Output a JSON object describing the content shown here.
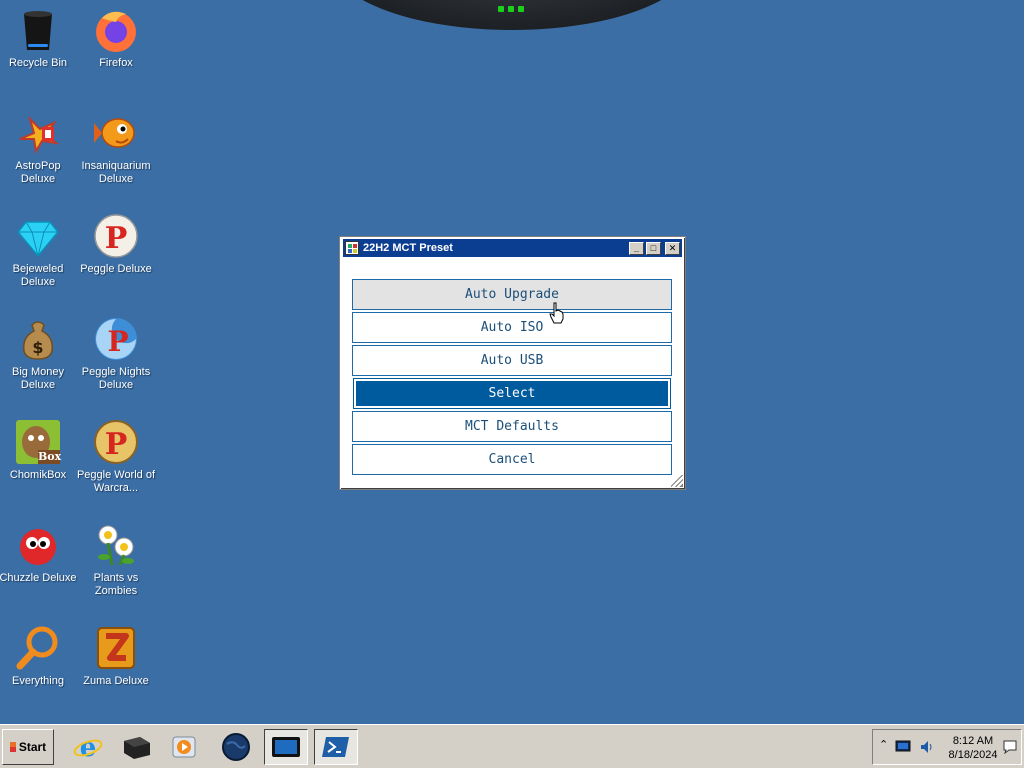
{
  "desktop": {
    "icons": [
      {
        "label": "Recycle Bin",
        "icon": "recycle-bin-icon"
      },
      {
        "label": "Firefox",
        "icon": "firefox-icon"
      },
      {
        "label": "AstroPop Deluxe",
        "icon": "astropop-icon"
      },
      {
        "label": "Insaniquarium Deluxe",
        "icon": "insaniquarium-icon"
      },
      {
        "label": "Bejeweled Deluxe",
        "icon": "bejeweled-icon"
      },
      {
        "label": "Peggle Deluxe",
        "icon": "peggle-icon"
      },
      {
        "label": "Big Money Deluxe",
        "icon": "big-money-icon"
      },
      {
        "label": "Peggle Nights Deluxe",
        "icon": "peggle-nights-icon"
      },
      {
        "label": "ChomikBox",
        "icon": "chomikbox-icon"
      },
      {
        "label": "Peggle World of Warcra...",
        "icon": "peggle-wow-icon"
      },
      {
        "label": "Chuzzle Deluxe",
        "icon": "chuzzle-icon"
      },
      {
        "label": "Plants vs Zombies",
        "icon": "plants-vs-zombies-icon"
      },
      {
        "label": "Everything",
        "icon": "everything-search-icon"
      },
      {
        "label": "Zuma Deluxe",
        "icon": "zuma-icon"
      }
    ],
    "chomikbox_badge": "Box"
  },
  "dialog": {
    "title": "22H2 MCT Preset",
    "buttons": [
      {
        "label": "Auto Upgrade",
        "state": "hover"
      },
      {
        "label": "Auto ISO",
        "state": "normal"
      },
      {
        "label": "Auto USB",
        "state": "normal"
      },
      {
        "label": "Select",
        "state": "selected"
      },
      {
        "label": "MCT Defaults",
        "state": "normal"
      },
      {
        "label": "Cancel",
        "state": "normal"
      }
    ],
    "controls": {
      "minimize": "minimize-icon",
      "maximize": "maximize-icon",
      "close": "close-icon"
    }
  },
  "taskbar": {
    "start_label": "Start",
    "items": [
      "internet-explorer-icon",
      "terminal-box-icon",
      "media-player-icon",
      "globe-icon",
      "window-display-icon",
      "powershell-icon"
    ],
    "tray": {
      "time": "8:12 AM",
      "date": "8/18/2024",
      "icons": [
        "chevron-up-icon",
        "network-monitor-icon",
        "volume-icon",
        "action-center-icon"
      ]
    }
  },
  "colors": {
    "desktop": "#3b6ea5",
    "selected_button": "#005a9e",
    "button_border": "#1c6aa8"
  }
}
